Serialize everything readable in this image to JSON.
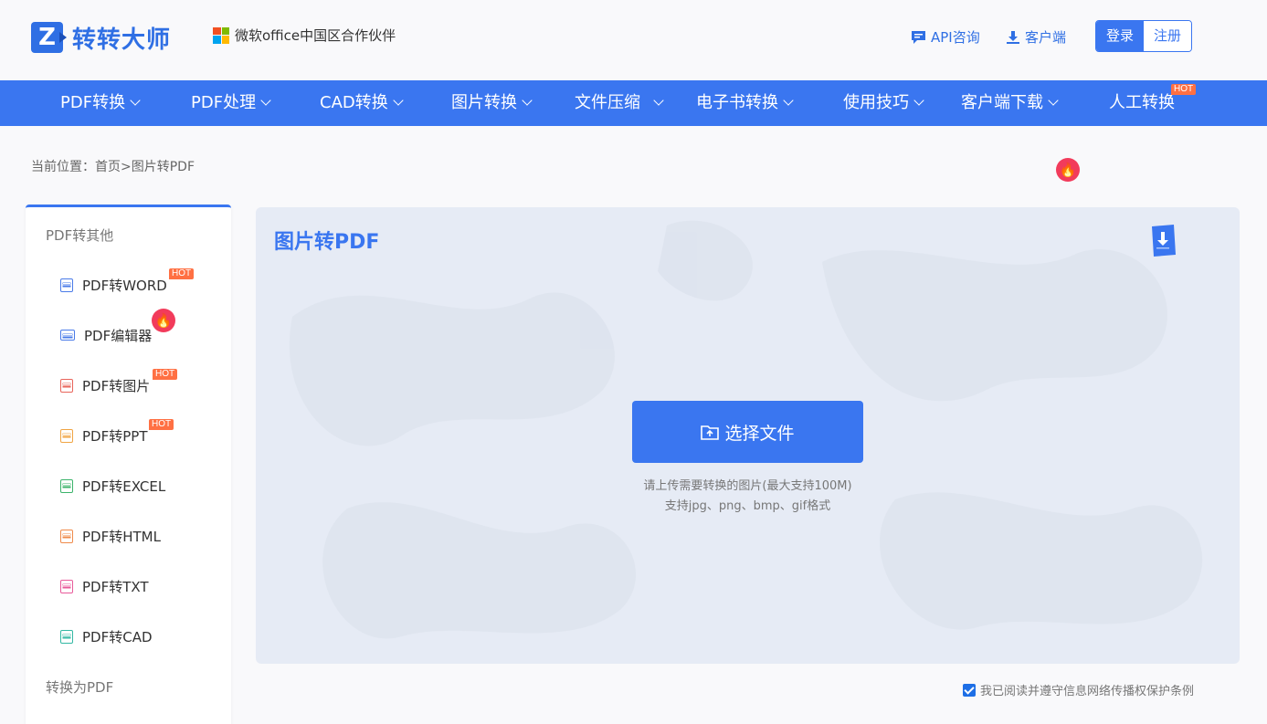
{
  "header": {
    "logo_text": "转转大师",
    "partner_text": "微软office中国区合作伙伴",
    "api_link": "API咨询",
    "client_link": "客户端",
    "login": "登录",
    "register": "注册"
  },
  "nav": {
    "items": [
      {
        "label": "PDF转换"
      },
      {
        "label": "PDF处理"
      },
      {
        "label": "CAD转换"
      },
      {
        "label": "图片转换"
      },
      {
        "label": "文件压缩"
      },
      {
        "label": "电子书转换"
      },
      {
        "label": "使用技巧"
      },
      {
        "label": "客户端下载"
      },
      {
        "label": "人工转换"
      }
    ],
    "hot_label": "HOT"
  },
  "breadcrumb": "当前位置：首页>图片转PDF",
  "sidebar": {
    "group1": "PDF转其他",
    "items": [
      {
        "label": "PDF转WORD",
        "badge": "HOT"
      },
      {
        "label": "PDF编辑器",
        "badge": "fire"
      },
      {
        "label": "PDF转图片",
        "badge": "HOT"
      },
      {
        "label": "PDF转PPT",
        "badge": "HOT"
      },
      {
        "label": "PDF转EXCEL"
      },
      {
        "label": "PDF转HTML"
      },
      {
        "label": "PDF转TXT"
      },
      {
        "label": "PDF转CAD"
      }
    ],
    "group2": "转换为PDF"
  },
  "main": {
    "title": "图片转PDF",
    "select_button": "选择文件",
    "hint1": "请上传需要转换的图片(最大支持100M)",
    "hint2": "支持jpg、png、bmp、gif格式"
  },
  "agreement": "我已阅读并遵守信息网络传播权保护条例",
  "colors": {
    "primary": "#3a76f0",
    "hot": "#ff7043",
    "fire": "#f23b5b"
  }
}
